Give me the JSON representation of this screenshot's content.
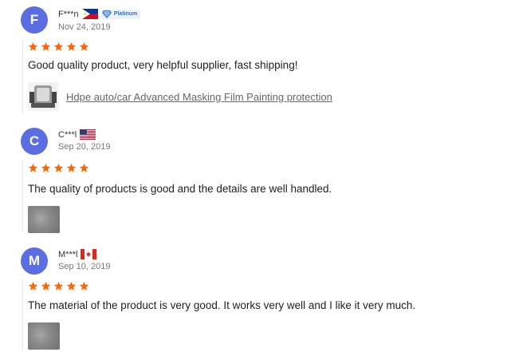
{
  "colors": {
    "star": "#ff6600",
    "avatar_f": "#5b6ee1",
    "avatar_c": "#5b6ee1",
    "avatar_m": "#5b6ee1"
  },
  "reviews": [
    {
      "initial": "F",
      "name": "F***n",
      "flag": "philippines-flag-icon",
      "badge": "Platinum",
      "date": "Nov 24, 2019",
      "rating": 5,
      "text": "Good quality product, very helpful supplier, fast shipping!",
      "product_link": "Hdpe auto/car Advanced Masking Film Painting protection"
    },
    {
      "initial": "C",
      "name": "C***l",
      "flag": "usa-flag-icon",
      "date": "Sep 20, 2019",
      "rating": 5,
      "text": "The quality of products is good and the details are well handled."
    },
    {
      "initial": "M",
      "name": "M***l",
      "flag": "canada-flag-icon",
      "date": "Sep 10, 2019",
      "rating": 5,
      "text": "The material of the product is very good. It works very well and I like it very much."
    }
  ]
}
